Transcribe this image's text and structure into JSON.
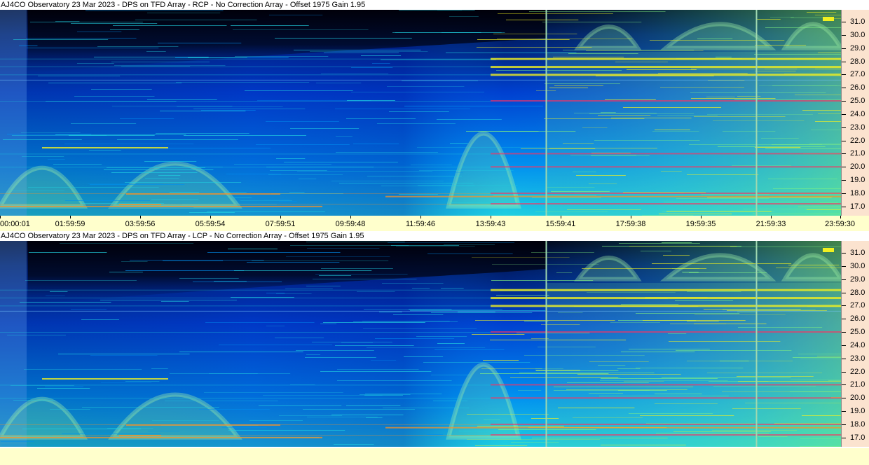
{
  "chart_data": [
    {
      "type": "heatmap",
      "title": "AJ4CO Observatory 23 Mar 2023 - DPS on TFD Array  - RCP  -  No Correction Array  -  Offset 1975  Gain 1.95",
      "xlabel": "",
      "ylabel": "",
      "x_ticks": [
        "00:00:01",
        "01:59:59",
        "03:59:56",
        "05:59:54",
        "07:59:51",
        "09:59:48",
        "11:59:46",
        "13:59:43",
        "15:59:41",
        "17:59:38",
        "19:59:35",
        "21:59:33",
        "23:59:30"
      ],
      "y_ticks": [
        31.0,
        30.0,
        29.0,
        28.0,
        27.0,
        26.0,
        25.0,
        24.0,
        23.0,
        22.0,
        21.0,
        20.0,
        19.0,
        18.0,
        17.0
      ],
      "y_tick_labels": [
        "31.0",
        "30.0",
        "29.0",
        "28.0",
        "27.0",
        "26.0",
        "25.0",
        "24.0",
        "23.0",
        "22.0",
        "21.0",
        "20.0",
        "19.0",
        "18.0",
        "17.0"
      ],
      "ylim": [
        16.3,
        31.9
      ],
      "colormap": [
        "#000010",
        "#001a60",
        "#0040d0",
        "#0090f0",
        "#20d0e0",
        "#80f080",
        "#f0f020",
        "#ff9020",
        "#ff3060"
      ],
      "vertical_markers_hours": [
        15.59,
        21.59
      ],
      "interference_bands_mhz": [
        27.0,
        27.6,
        28.2,
        25.0,
        21.0,
        20.0,
        18.0,
        17.2
      ],
      "sweep_arcs": [
        {
          "start_h": 0.0,
          "peak_h": 1.2,
          "end_h": 2.4,
          "low_mhz": 17.0,
          "high_mhz": 21.5
        },
        {
          "start_h": 3.2,
          "peak_h": 5.0,
          "end_h": 6.8,
          "low_mhz": 17.0,
          "high_mhz": 22.0
        },
        {
          "start_h": 12.8,
          "peak_h": 13.8,
          "end_h": 14.8,
          "low_mhz": 17.0,
          "high_mhz": 25.5
        },
        {
          "start_h": 16.5,
          "peak_h": 17.4,
          "end_h": 18.2,
          "low_mhz": 29.0,
          "high_mhz": 31.5
        },
        {
          "start_h": 19.0,
          "peak_h": 20.6,
          "end_h": 22.0,
          "low_mhz": 29.0,
          "high_mhz": 31.8
        },
        {
          "start_h": 22.4,
          "peak_h": 23.2,
          "end_h": 24.0,
          "low_mhz": 29.0,
          "high_mhz": 31.8
        }
      ]
    },
    {
      "type": "heatmap",
      "title": "AJ4CO Observatory 23 Mar 2023 - DPS on TFD Array  - LCP  -  No Correction Array  -  Offset 1975  Gain 1.95",
      "xlabel": "",
      "ylabel": "",
      "x_ticks": [],
      "y_ticks": [
        31.0,
        30.0,
        29.0,
        28.0,
        27.0,
        26.0,
        25.0,
        24.0,
        23.0,
        22.0,
        21.0,
        20.0,
        19.0,
        18.0,
        17.0
      ],
      "y_tick_labels": [
        "31.0",
        "30.0",
        "29.0",
        "28.0",
        "27.0",
        "26.0",
        "25.0",
        "24.0",
        "23.0",
        "22.0",
        "21.0",
        "20.0",
        "19.0",
        "18.0",
        "17.0"
      ],
      "ylim": [
        16.3,
        31.9
      ],
      "colormap": [
        "#000010",
        "#001a60",
        "#0040d0",
        "#0090f0",
        "#20d0e0",
        "#80f080",
        "#f0f020",
        "#ff9020",
        "#ff3060"
      ],
      "vertical_markers_hours": [
        15.59,
        21.59
      ],
      "interference_bands_mhz": [
        27.0,
        27.6,
        28.2,
        25.0,
        21.0,
        20.0,
        18.0,
        17.2
      ],
      "sweep_arcs": [
        {
          "start_h": 0.0,
          "peak_h": 1.2,
          "end_h": 2.4,
          "low_mhz": 17.0,
          "high_mhz": 21.5
        },
        {
          "start_h": 3.2,
          "peak_h": 5.0,
          "end_h": 6.8,
          "low_mhz": 17.0,
          "high_mhz": 22.0
        },
        {
          "start_h": 12.8,
          "peak_h": 13.8,
          "end_h": 14.8,
          "low_mhz": 17.0,
          "high_mhz": 25.5
        },
        {
          "start_h": 16.5,
          "peak_h": 17.4,
          "end_h": 18.2,
          "low_mhz": 29.0,
          "high_mhz": 31.5
        },
        {
          "start_h": 19.0,
          "peak_h": 20.6,
          "end_h": 22.0,
          "low_mhz": 29.0,
          "high_mhz": 31.8
        },
        {
          "start_h": 22.4,
          "peak_h": 23.2,
          "end_h": 24.0,
          "low_mhz": 29.0,
          "high_mhz": 31.8
        }
      ]
    }
  ]
}
